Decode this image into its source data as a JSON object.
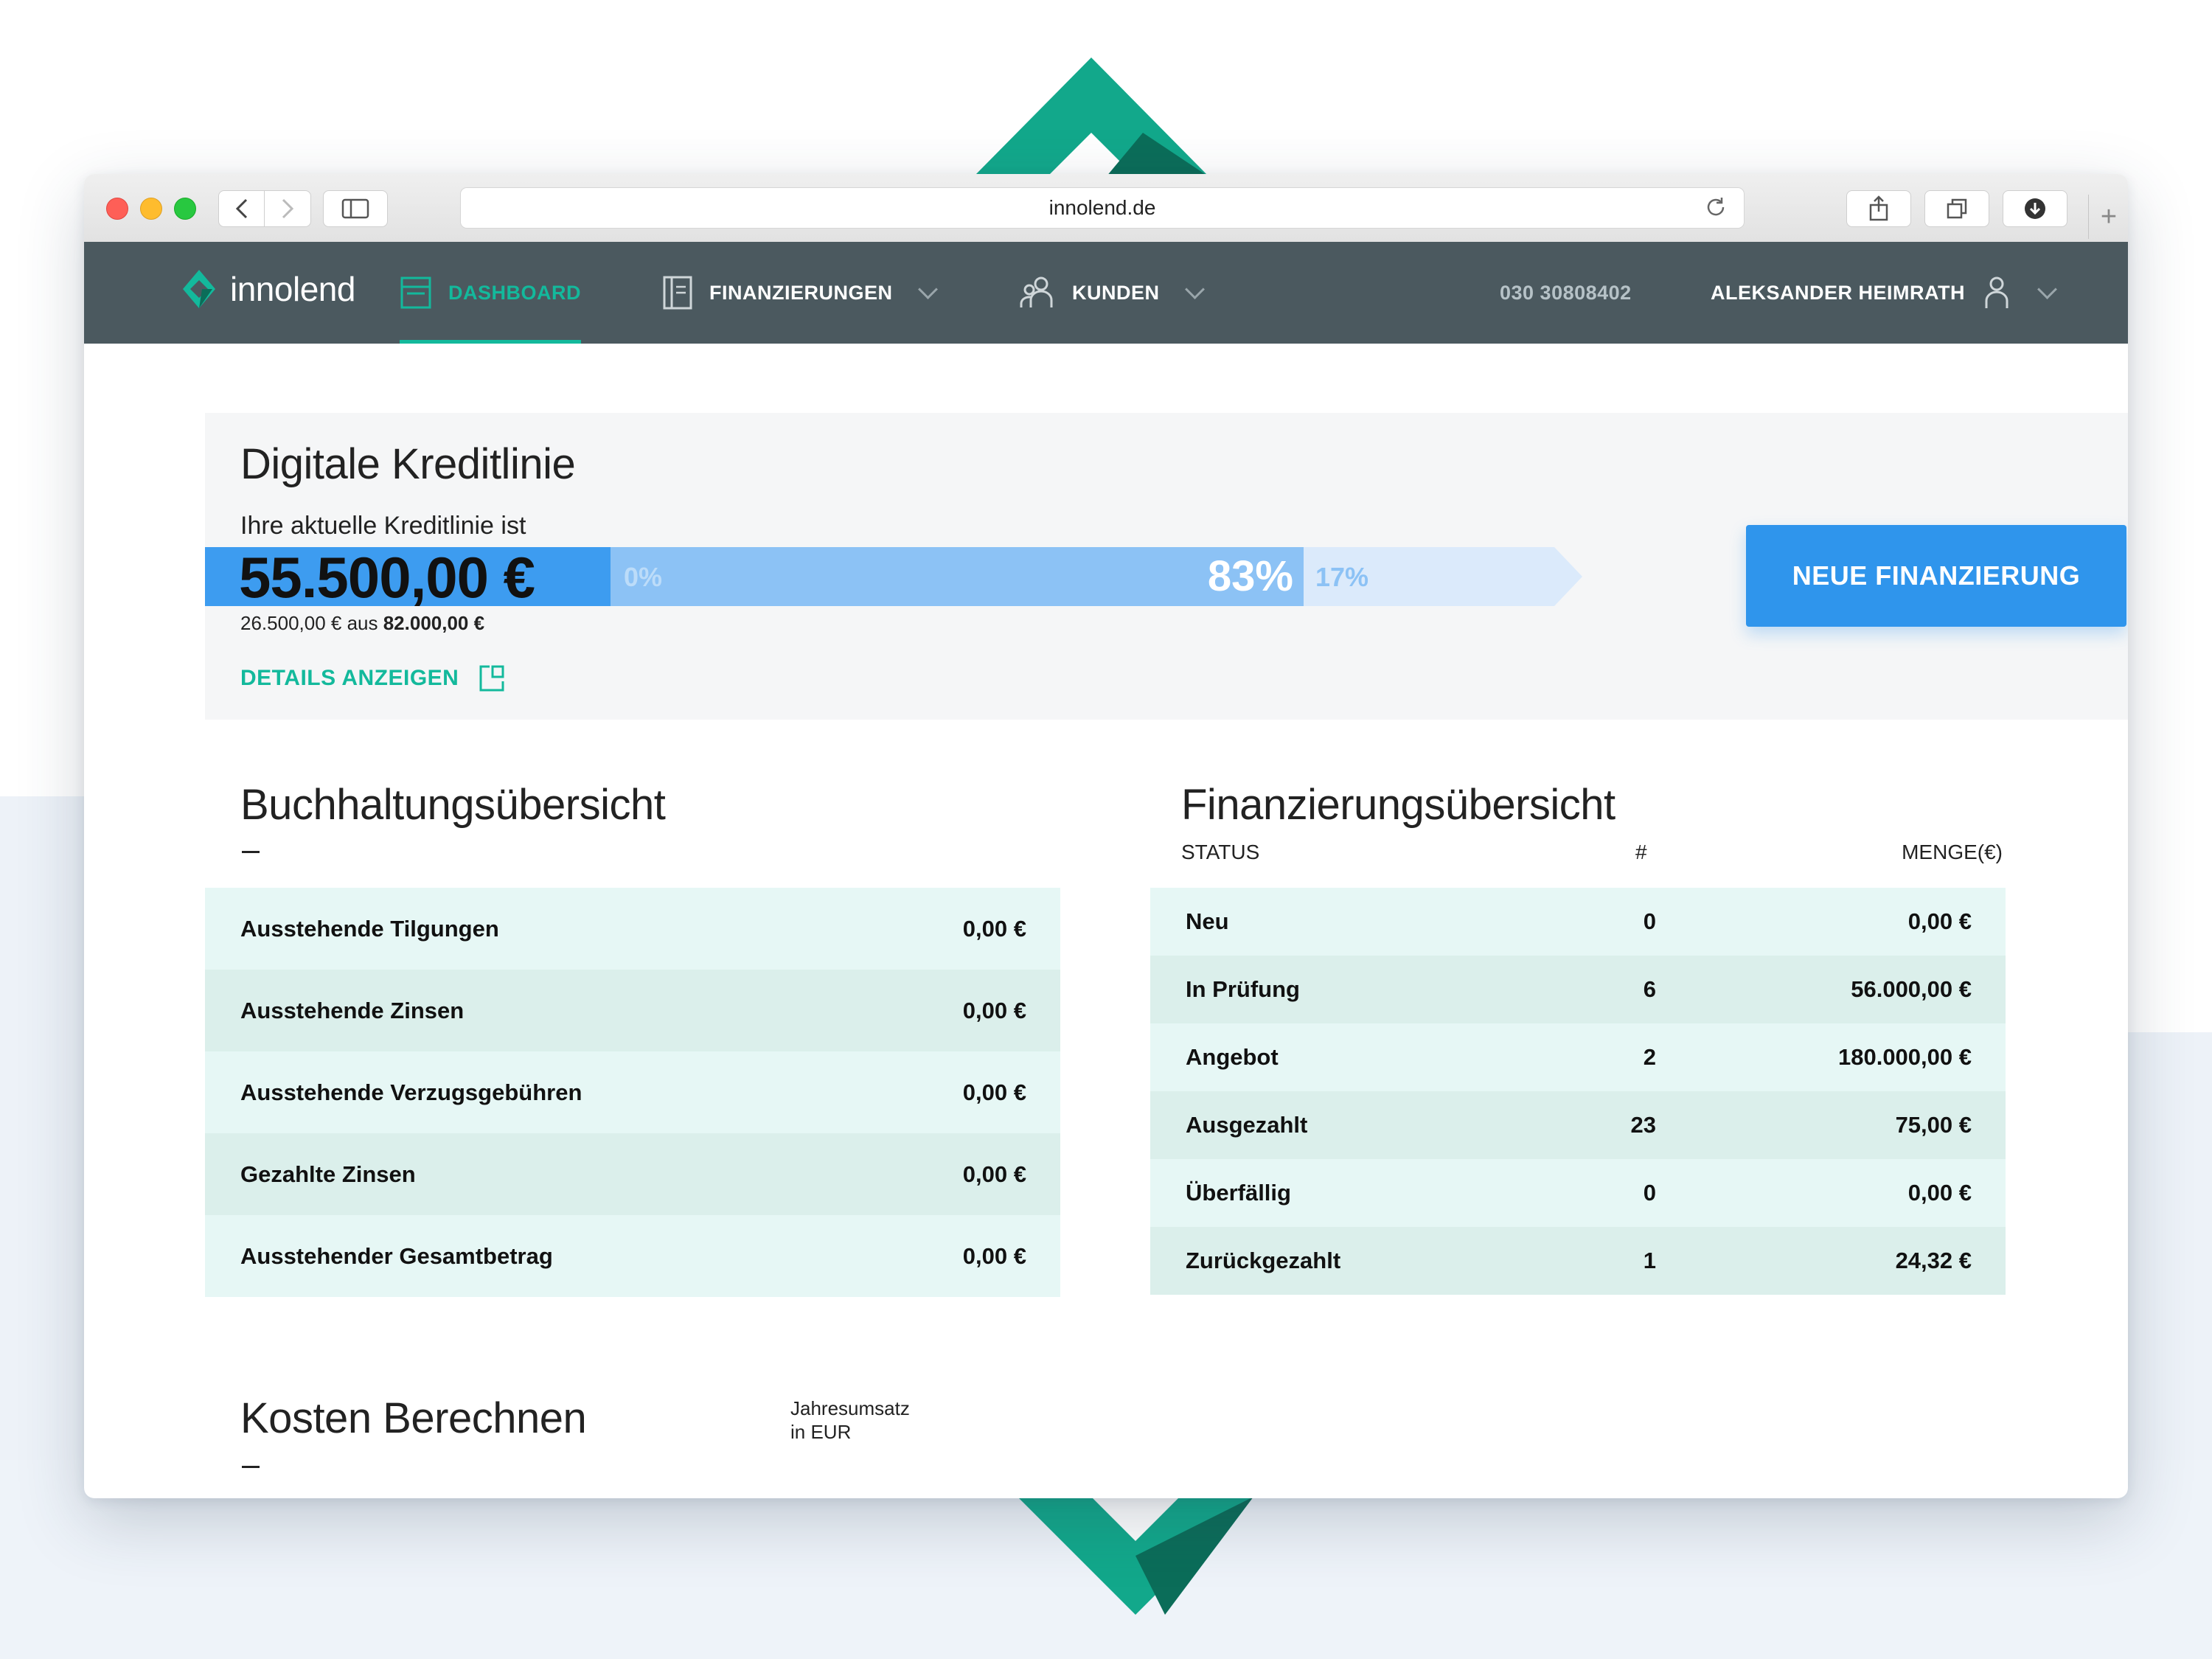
{
  "browser": {
    "url": "innolend.de"
  },
  "nav": {
    "brand": "innolend",
    "items": [
      {
        "label": "DASHBOARD",
        "active": true
      },
      {
        "label": "FINANZIERUNGEN"
      },
      {
        "label": "KUNDEN"
      }
    ],
    "phone": "030 30808402",
    "user": "ALEKSANDER HEIMRATH"
  },
  "credit": {
    "title": "Digitale Kreditlinie",
    "subtitle": "Ihre aktuelle Kreditlinie ist",
    "amount": "55.500,00 €",
    "pct_start": "0%",
    "pct_used": "83%",
    "pct_rest": "17%",
    "sum_used": "26.500,00 € aus ",
    "sum_total": "82.000,00 €",
    "details_link": "DETAILS ANZEIGEN",
    "cta": "NEUE FINANZIERUNG"
  },
  "accounting": {
    "title": "Buchhaltungsübersicht",
    "rows": [
      {
        "label": "Ausstehende Tilgungen",
        "value": "0,00 €"
      },
      {
        "label": "Ausstehende Zinsen",
        "value": "0,00 €"
      },
      {
        "label": "Ausstehende Verzugsgebühren",
        "value": "0,00 €"
      },
      {
        "label": "Gezahlte Zinsen",
        "value": "0,00 €"
      },
      {
        "label": "Ausstehender Gesamtbetrag",
        "value": "0,00 €"
      }
    ]
  },
  "financing": {
    "title": "Finanzierungsübersicht",
    "headers": {
      "status": "STATUS",
      "count": "#",
      "amount": "MENGE(€)"
    },
    "rows": [
      {
        "status": "Neu",
        "count": "0",
        "amount": "0,00 €"
      },
      {
        "status": "In Prüfung",
        "count": "6",
        "amount": "56.000,00 €"
      },
      {
        "status": "Angebot",
        "count": "2",
        "amount": "180.000,00 €"
      },
      {
        "status": "Ausgezahlt",
        "count": "23",
        "amount": "75,00 €"
      },
      {
        "status": "Überfällig",
        "count": "0",
        "amount": "0,00 €"
      },
      {
        "status": "Zurückgezahlt",
        "count": "1",
        "amount": "24,32 €"
      }
    ]
  },
  "costs": {
    "title": "Kosten Berechnen",
    "label_line1": "Jahresumsatz",
    "label_line2": "in EUR"
  },
  "colors": {
    "accent": "#13b99c",
    "nav_bg": "#4b595f",
    "cta": "#2f95ec",
    "bar_used": "#3d9cf0",
    "bar_mid": "#8cc2f5",
    "bar_rest": "#dbeafb"
  }
}
